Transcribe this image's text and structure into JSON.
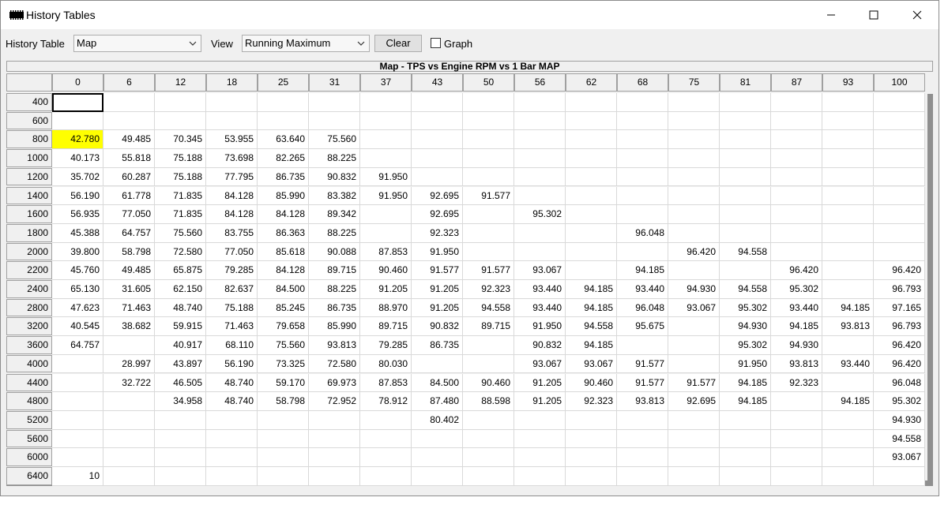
{
  "window": {
    "title": "History Tables",
    "minimize": "—",
    "maximize": "☐",
    "close": "✕"
  },
  "toolbar": {
    "history_table_label": "History Table",
    "history_table_value": "Map",
    "view_label": "View",
    "view_value": "Running Maximum",
    "clear_label": "Clear",
    "graph_label": "Graph",
    "graph_checked": false
  },
  "table": {
    "title": "Map - TPS vs Engine RPM vs 1 Bar MAP",
    "columns": [
      "0",
      "6",
      "12",
      "18",
      "25",
      "31",
      "37",
      "43",
      "50",
      "56",
      "62",
      "68",
      "75",
      "81",
      "87",
      "93",
      "100"
    ],
    "rows": [
      {
        "rpm": "400",
        "cells": [
          "",
          "",
          "",
          "",
          "",
          "",
          "",
          "",
          "",
          "",
          "",
          "",
          "",
          "",
          "",
          "",
          ""
        ]
      },
      {
        "rpm": "600",
        "cells": [
          "",
          "",
          "",
          "",
          "",
          "",
          "",
          "",
          "",
          "",
          "",
          "",
          "",
          "",
          "",
          "",
          ""
        ]
      },
      {
        "rpm": "800",
        "cells": [
          "42.780",
          "49.485",
          "70.345",
          "53.955",
          "63.640",
          "75.560",
          "",
          "",
          "",
          "",
          "",
          "",
          "",
          "",
          "",
          "",
          ""
        ]
      },
      {
        "rpm": "1000",
        "cells": [
          "40.173",
          "55.818",
          "75.188",
          "73.698",
          "82.265",
          "88.225",
          "",
          "",
          "",
          "",
          "",
          "",
          "",
          "",
          "",
          "",
          ""
        ]
      },
      {
        "rpm": "1200",
        "cells": [
          "35.702",
          "60.287",
          "75.188",
          "77.795",
          "86.735",
          "90.832",
          "91.950",
          "",
          "",
          "",
          "",
          "",
          "",
          "",
          "",
          "",
          ""
        ]
      },
      {
        "rpm": "1400",
        "cells": [
          "56.190",
          "61.778",
          "71.835",
          "84.128",
          "85.990",
          "83.382",
          "91.950",
          "92.695",
          "91.577",
          "",
          "",
          "",
          "",
          "",
          "",
          "",
          ""
        ]
      },
      {
        "rpm": "1600",
        "cells": [
          "56.935",
          "77.050",
          "71.835",
          "84.128",
          "84.128",
          "89.342",
          "",
          "92.695",
          "",
          "95.302",
          "",
          "",
          "",
          "",
          "",
          "",
          ""
        ]
      },
      {
        "rpm": "1800",
        "cells": [
          "45.388",
          "64.757",
          "75.560",
          "83.755",
          "86.363",
          "88.225",
          "",
          "92.323",
          "",
          "",
          "",
          "96.048",
          "",
          "",
          "",
          "",
          ""
        ]
      },
      {
        "rpm": "2000",
        "cells": [
          "39.800",
          "58.798",
          "72.580",
          "77.050",
          "85.618",
          "90.088",
          "87.853",
          "91.950",
          "",
          "",
          "",
          "",
          "96.420",
          "94.558",
          "",
          "",
          ""
        ]
      },
      {
        "rpm": "2200",
        "cells": [
          "45.760",
          "49.485",
          "65.875",
          "79.285",
          "84.128",
          "89.715",
          "90.460",
          "91.577",
          "91.577",
          "93.067",
          "",
          "94.185",
          "",
          "",
          "96.420",
          "",
          "96.420"
        ]
      },
      {
        "rpm": "2400",
        "cells": [
          "65.130",
          "31.605",
          "62.150",
          "82.637",
          "84.500",
          "88.225",
          "91.205",
          "91.205",
          "92.323",
          "93.440",
          "94.185",
          "93.440",
          "94.930",
          "94.558",
          "95.302",
          "",
          "96.793"
        ]
      },
      {
        "rpm": "2800",
        "cells": [
          "47.623",
          "71.463",
          "48.740",
          "75.188",
          "85.245",
          "86.735",
          "88.970",
          "91.205",
          "94.558",
          "93.440",
          "94.185",
          "96.048",
          "93.067",
          "95.302",
          "93.440",
          "94.185",
          "97.165"
        ]
      },
      {
        "rpm": "3200",
        "cells": [
          "40.545",
          "38.682",
          "59.915",
          "71.463",
          "79.658",
          "85.990",
          "89.715",
          "90.832",
          "89.715",
          "91.950",
          "94.558",
          "95.675",
          "",
          "94.930",
          "94.185",
          "93.813",
          "96.793"
        ]
      },
      {
        "rpm": "3600",
        "cells": [
          "64.757",
          "",
          "40.917",
          "68.110",
          "75.560",
          "93.813",
          "79.285",
          "86.735",
          "",
          "90.832",
          "94.185",
          "",
          "",
          "95.302",
          "94.930",
          "",
          "96.420"
        ]
      },
      {
        "rpm": "4000",
        "cells": [
          "",
          "28.997",
          "43.897",
          "56.190",
          "73.325",
          "72.580",
          "80.030",
          "",
          "",
          "93.067",
          "93.067",
          "91.577",
          "",
          "91.950",
          "93.813",
          "93.440",
          "96.420"
        ]
      },
      {
        "rpm": "4400",
        "cells": [
          "",
          "32.722",
          "46.505",
          "48.740",
          "59.170",
          "69.973",
          "87.853",
          "84.500",
          "90.460",
          "91.205",
          "90.460",
          "91.577",
          "91.577",
          "94.185",
          "92.323",
          "",
          "96.048"
        ]
      },
      {
        "rpm": "4800",
        "cells": [
          "",
          "",
          "34.958",
          "48.740",
          "58.798",
          "72.952",
          "78.912",
          "87.480",
          "88.598",
          "91.205",
          "92.323",
          "93.813",
          "92.695",
          "94.185",
          "",
          "94.185",
          "95.302"
        ]
      },
      {
        "rpm": "5200",
        "cells": [
          "",
          "",
          "",
          "",
          "",
          "",
          "",
          "80.402",
          "",
          "",
          "",
          "",
          "",
          "",
          "",
          "",
          "94.930"
        ]
      },
      {
        "rpm": "5600",
        "cells": [
          "",
          "",
          "",
          "",
          "",
          "",
          "",
          "",
          "",
          "",
          "",
          "",
          "",
          "",
          "",
          "",
          "94.558"
        ]
      },
      {
        "rpm": "6000",
        "cells": [
          "",
          "",
          "",
          "",
          "",
          "",
          "",
          "",
          "",
          "",
          "",
          "",
          "",
          "",
          "",
          "",
          "93.067"
        ]
      },
      {
        "rpm": "6400",
        "cells": [
          "10",
          "",
          "",
          "",
          "",
          "",
          "",
          "",
          "",
          "",
          "",
          "",
          "",
          "",
          "",
          "",
          ""
        ]
      }
    ],
    "highlight_color": "#ffff00"
  }
}
